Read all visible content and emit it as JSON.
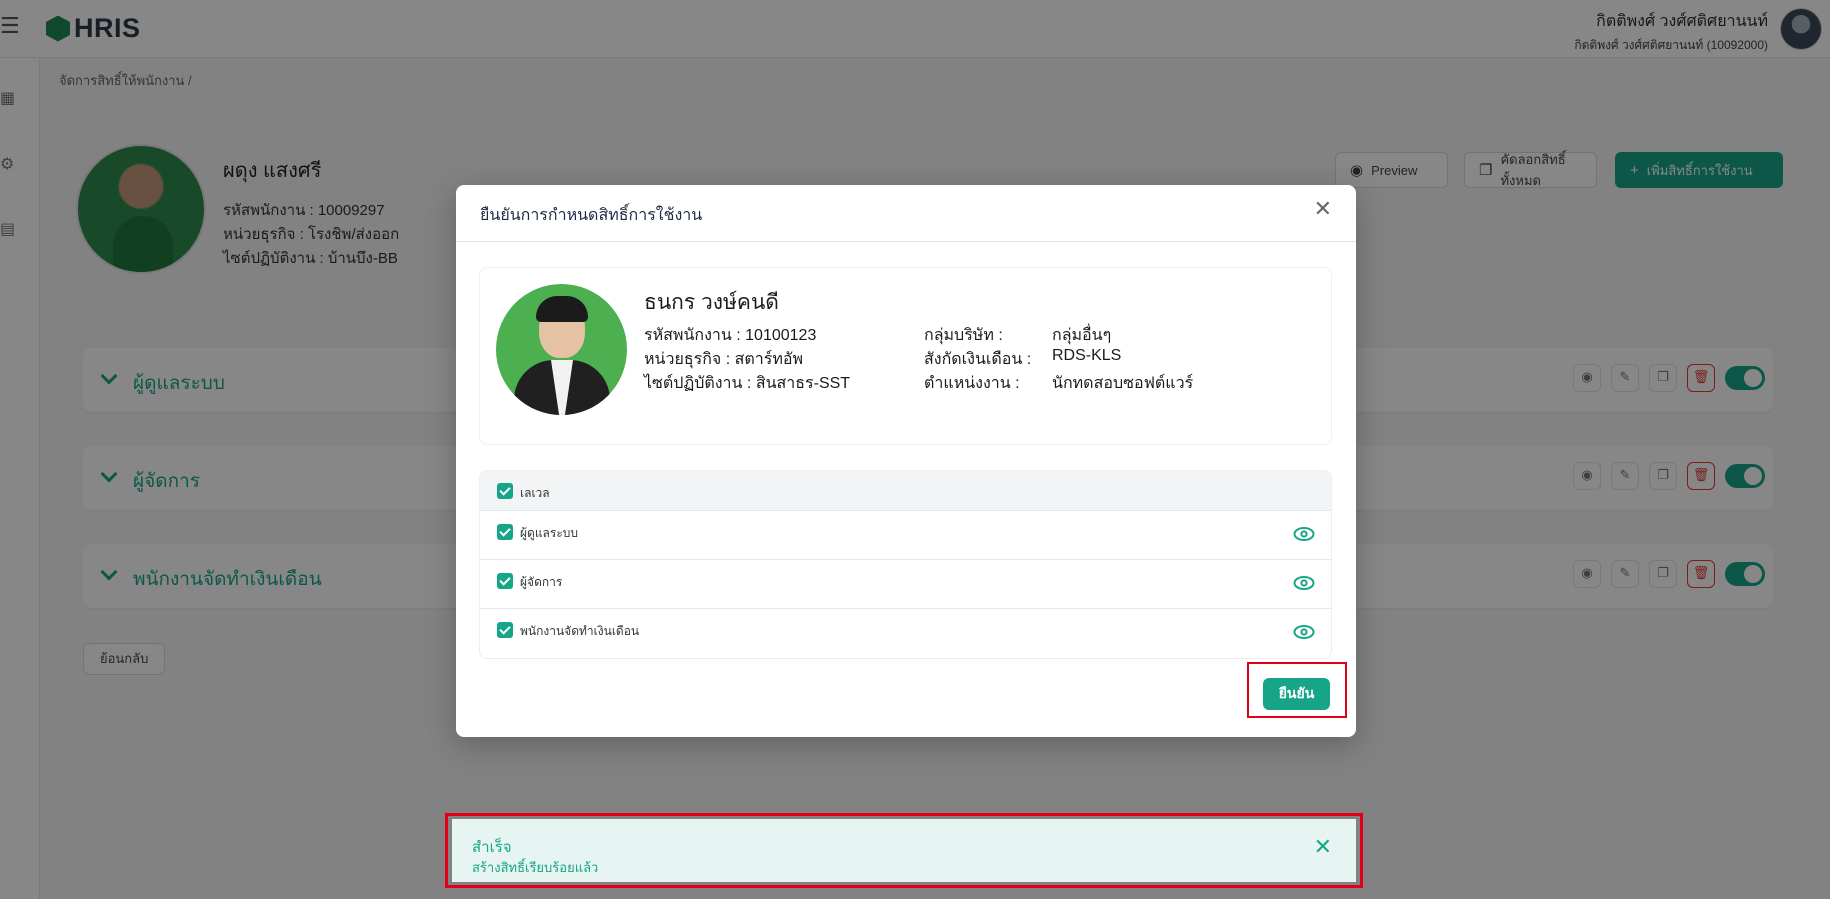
{
  "header": {
    "logo_text": "HRIS",
    "user_name": "กิตติพงศ์ วงศ์ศติศยานนท์",
    "user_sub": "กิตติพงศ์ วงศ์ศติศยานนท์ (10092000)"
  },
  "breadcrumb": "จัดการสิทธิ์ให้พนักงาน /",
  "employee": {
    "name": "ผดุง แสงศรี",
    "code_line": "รหัสพนักงาน : 10009297",
    "unit_line": "หน่วยธุรกิจ : โรงชิพ/ส่งออก",
    "site_line": "ไซต์ปฏิบัติงาน : บ้านบึง-BB"
  },
  "page_actions": {
    "preview": "Preview",
    "copy_all": "คัดลอกสิทธิ์ทั้งหมด",
    "add_permission": "เพิ่มสิทธิ์การใช้งาน"
  },
  "groups": [
    {
      "label": "ผู้ดูแลระบบ"
    },
    {
      "label": "ผู้จัดการ"
    },
    {
      "label": "พนักงานจัดทำเงินเดือน"
    }
  ],
  "back_button": "ย้อนกลับ",
  "modal": {
    "title": "ยืนยันการกำหนดสิทธิ์การใช้งาน",
    "employee": {
      "name": "ธนกร วงษ์คนดี",
      "code": "รหัสพนักงาน : 10100123",
      "unit": "หน่วยธุรกิจ : สตาร์ทอัพ",
      "site": "ไซต์ปฏิบัติงาน : สินสาธร-SST",
      "company_group_label": "กลุ่มบริษัท :",
      "company_group_value": "กลุ่มอื่นๆ",
      "payroll_label": "สังกัดเงินเดือน :",
      "payroll_value": "RDS-KLS",
      "position_label": "ตำแหน่งงาน :",
      "position_value": "นักทดสอบซอฟต์แวร์"
    },
    "table_header": "เลเวล",
    "levels": [
      {
        "label": "ผู้ดูแลระบบ",
        "checked": true
      },
      {
        "label": "ผู้จัดการ",
        "checked": true
      },
      {
        "label": "พนักงานจัดทำเงินเดือน",
        "checked": true
      }
    ],
    "confirm": "ยืนยัน"
  },
  "toast": {
    "title": "สำเร็จ",
    "message": "สร้างสิทธิ์เรียบร้อยแล้ว"
  },
  "colors": {
    "accent": "#17a589",
    "danger": "#e53935",
    "highlight": "#e0001a"
  }
}
